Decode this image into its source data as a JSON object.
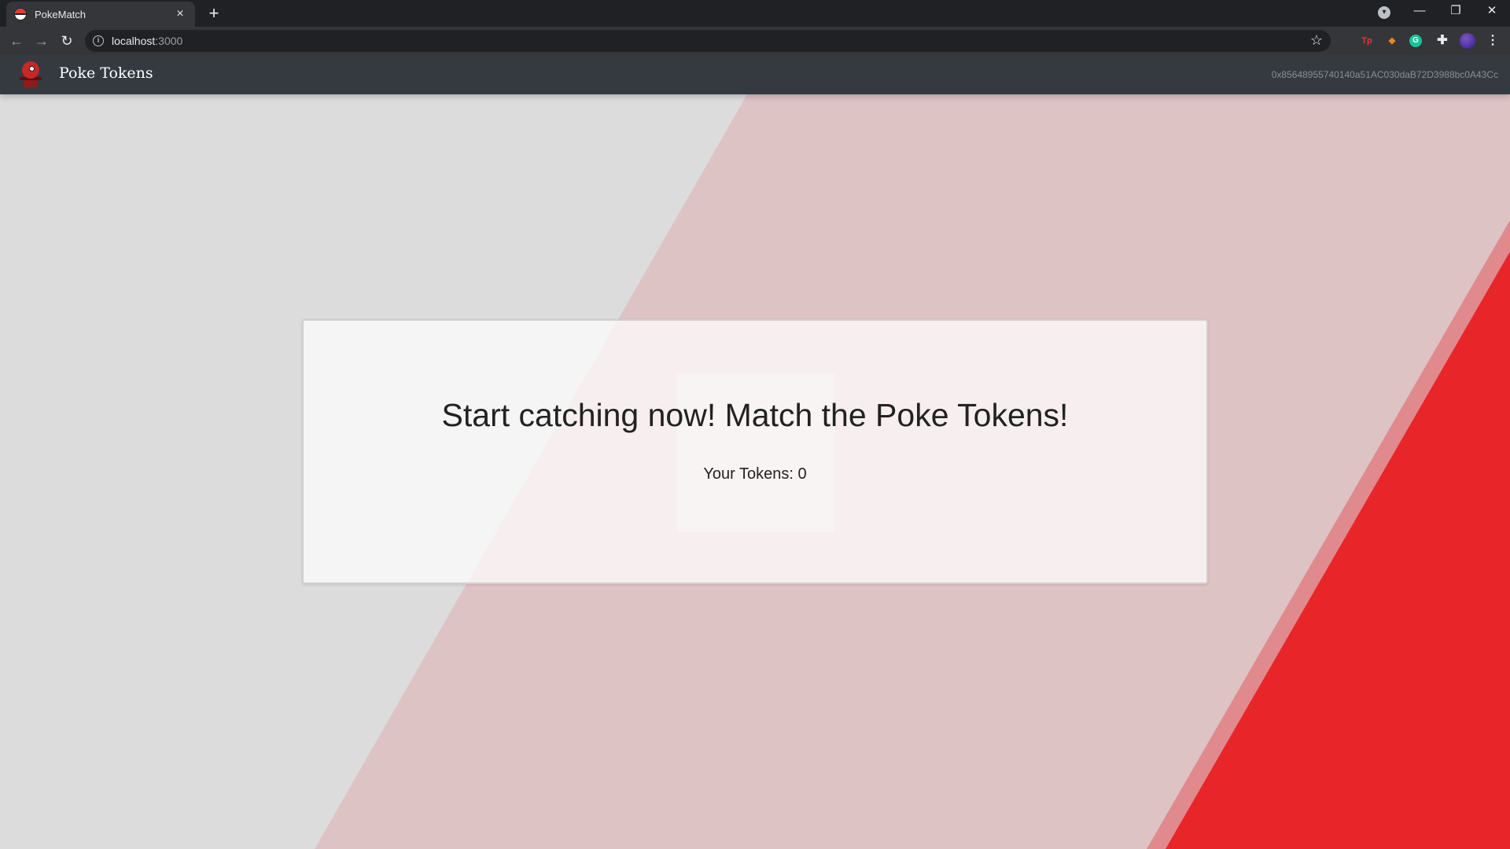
{
  "browser": {
    "tab_title": "PokeMatch",
    "url_host": "localhost",
    "url_port": ":3000"
  },
  "app": {
    "brand": "Poke Tokens",
    "account_address": "0x85648955740140a51AC030daB72D3988bc0A43Cc",
    "headline": "Start catching now! Match the Poke Tokens!",
    "tokens_label": "Your Tokens: 0"
  },
  "extensions": [
    "Tp",
    "metamask-fox",
    "G",
    "puzzle",
    "profile-avatar"
  ],
  "colors": {
    "navbar": "#343a40",
    "background": "#dcdcdc",
    "pink_stripe": "#dec3c5",
    "red_accent": "#e8262a"
  }
}
